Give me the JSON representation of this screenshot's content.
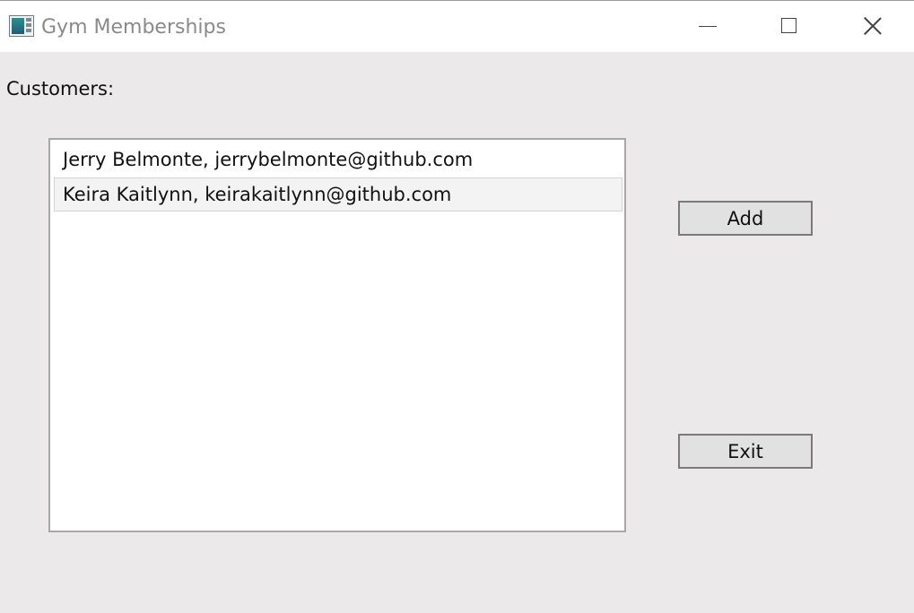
{
  "window": {
    "title": "Gym Memberships",
    "icon": "app-icon"
  },
  "caption_buttons": {
    "minimize_icon": "minimize-icon",
    "maximize_icon": "maximize-icon",
    "close_icon": "close-icon"
  },
  "main": {
    "customers_label": "Customers:",
    "customers": [
      {
        "label": "Jerry Belmonte, jerrybelmonte@github.com",
        "selected": false
      },
      {
        "label": "Keira Kaitlynn, keirakaitlynn@github.com",
        "selected": true
      }
    ],
    "add_label": "Add",
    "exit_label": "Exit"
  },
  "colors": {
    "window_background": "#ebe9e9",
    "titlebar_background": "#ffffff",
    "button_face": "#e1e1e1",
    "selection_background": "#f3f3f3"
  }
}
